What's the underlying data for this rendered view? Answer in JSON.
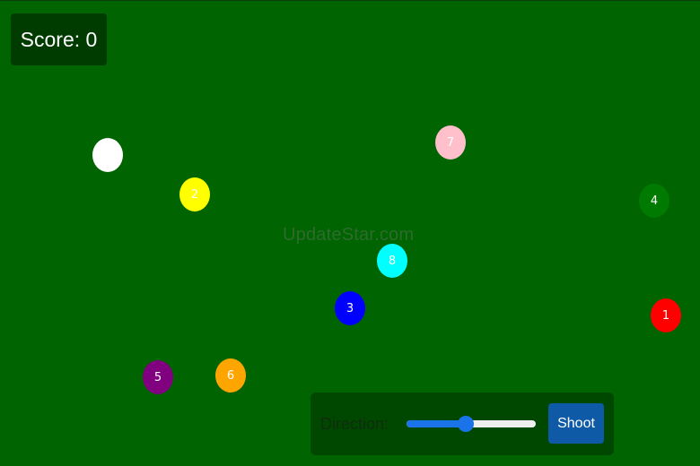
{
  "score": {
    "label": "Score: 0"
  },
  "watermark": "UpdateStar.com",
  "balls": [
    {
      "name": "cue-ball",
      "label": "",
      "color": "#ffffff"
    },
    {
      "name": "ball-2",
      "label": "2",
      "color": "#ffff00"
    },
    {
      "name": "ball-7",
      "label": "7",
      "color": "#ffc0cb"
    },
    {
      "name": "ball-4",
      "label": "4",
      "color": "#007a00"
    },
    {
      "name": "ball-8",
      "label": "8",
      "color": "#00ffff"
    },
    {
      "name": "ball-3",
      "label": "3",
      "color": "#0000ff"
    },
    {
      "name": "ball-1",
      "label": "1",
      "color": "#ff0000"
    },
    {
      "name": "ball-5",
      "label": "5",
      "color": "#800080"
    },
    {
      "name": "ball-6",
      "label": "6",
      "color": "#ffa500"
    }
  ],
  "controls": {
    "direction_label": "Direction:",
    "direction_value_fraction": 0.46,
    "shoot_label": "Shoot",
    "accent_color": "#1a73e8"
  }
}
